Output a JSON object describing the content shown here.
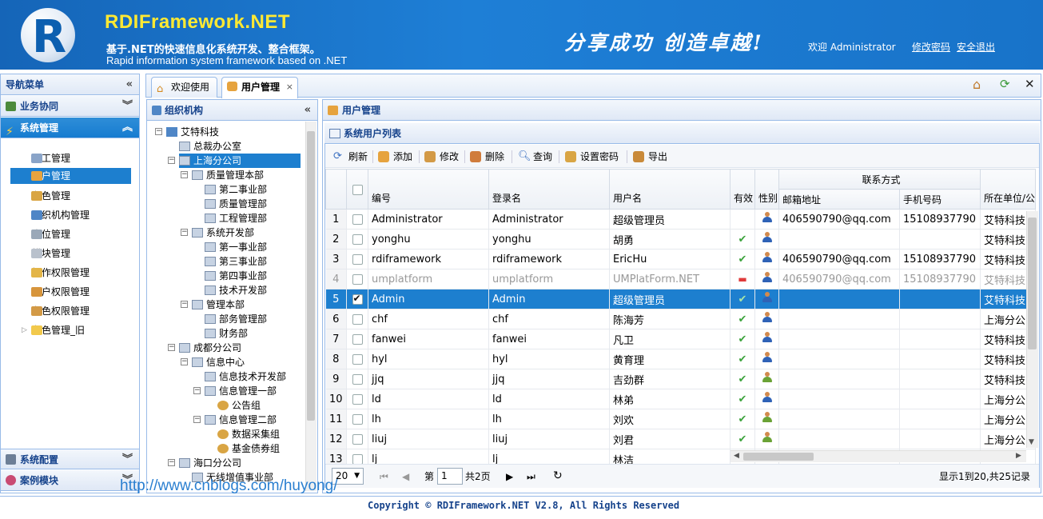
{
  "header": {
    "logo_letter": "R",
    "title": "RDIFramework.NET",
    "subtitle_cn": "基于.NET的快速信息化系统开发、整合框架。",
    "subtitle_en": "Rapid information system framework based on .NET",
    "slogan": "分享成功  创造卓越!",
    "welcome": "欢迎 Administrator",
    "change_password": "修改密码",
    "logout": "安全退出"
  },
  "nav": {
    "title": "导航菜单",
    "sections": [
      "业务协同",
      "系统管理"
    ],
    "items": [
      "员工管理",
      "用户管理",
      "角色管理",
      "组织机构管理",
      "岗位管理",
      "模块管理",
      "操作权限管理",
      "用户权限管理",
      "角色权限管理",
      "角色管理_旧"
    ],
    "bottom_sections": [
      "系统配置",
      "案例模块"
    ]
  },
  "tabs": [
    "欢迎使用",
    "用户管理"
  ],
  "tree": {
    "title": "组织机构",
    "nodes": [
      "艾特科技",
      "总裁办公室",
      "上海分公司",
      "质量管理本部",
      "第二事业部",
      "质量管理部",
      "工程管理部",
      "系统开发部",
      "第一事业部",
      "第三事业部",
      "第四事业部",
      "技术开发部",
      "管理本部",
      "部务管理部",
      "财务部",
      "成都分公司",
      "信息中心",
      "信息技术开发部",
      "信息管理一部",
      "公告组",
      "信息管理二部",
      "数据采集组",
      "基金债券组",
      "海口分公司",
      "无线增值事业部"
    ]
  },
  "main": {
    "title": "用户管理",
    "list_title": "系统用户列表",
    "toolbar": [
      "刷新",
      "添加",
      "修改",
      "删除",
      "查询",
      "设置密码",
      "导出"
    ],
    "group_header": "联系方式",
    "columns": [
      "编号",
      "登录名",
      "用户名",
      "有效",
      "性别",
      "邮箱地址",
      "手机号码",
      "所在单位/公"
    ],
    "rows": [
      {
        "n": "1",
        "code": "Administrator",
        "login": "Administrator",
        "name": "超级管理员",
        "valid": "",
        "gender": "m",
        "email": "406590790@qq.com",
        "mobile": "15108937790",
        "unit": "艾特科技"
      },
      {
        "n": "2",
        "code": "yonghu",
        "login": "yonghu",
        "name": "胡勇",
        "valid": "✔",
        "gender": "m",
        "email": "",
        "mobile": "",
        "unit": "艾特科技"
      },
      {
        "n": "3",
        "code": "rdiframework",
        "login": "rdiframework",
        "name": "EricHu",
        "valid": "✔",
        "gender": "m",
        "email": "406590790@qq.com",
        "mobile": "15108937790",
        "unit": "艾特科技"
      },
      {
        "n": "4",
        "code": "umplatform",
        "login": "umplatform",
        "name": "UMPlatForm.NET",
        "valid": "▬",
        "gender": "m",
        "email": "406590790@qq.com",
        "mobile": "15108937790",
        "unit": "艾特科技"
      },
      {
        "n": "5",
        "code": "Admin",
        "login": "Admin",
        "name": "超级管理员",
        "valid": "✔",
        "gender": "m",
        "email": "",
        "mobile": "",
        "unit": "艾特科技"
      },
      {
        "n": "6",
        "code": "chf",
        "login": "chf",
        "name": "陈海芳",
        "valid": "✔",
        "gender": "m",
        "email": "",
        "mobile": "",
        "unit": "上海分公"
      },
      {
        "n": "7",
        "code": "fanwei",
        "login": "fanwei",
        "name": "凡卫",
        "valid": "✔",
        "gender": "m",
        "email": "",
        "mobile": "",
        "unit": "艾特科技"
      },
      {
        "n": "8",
        "code": "hyl",
        "login": "hyl",
        "name": "黄育理",
        "valid": "✔",
        "gender": "m",
        "email": "",
        "mobile": "",
        "unit": "艾特科技"
      },
      {
        "n": "9",
        "code": "jjq",
        "login": "jjq",
        "name": "吉劲群",
        "valid": "✔",
        "gender": "f",
        "email": "",
        "mobile": "",
        "unit": "艾特科技"
      },
      {
        "n": "10",
        "code": "ld",
        "login": "ld",
        "name": "林弟",
        "valid": "✔",
        "gender": "m",
        "email": "",
        "mobile": "",
        "unit": "上海分公"
      },
      {
        "n": "11",
        "code": "lh",
        "login": "lh",
        "name": "刘欢",
        "valid": "✔",
        "gender": "f",
        "email": "",
        "mobile": "",
        "unit": "上海分公"
      },
      {
        "n": "12",
        "code": "liuj",
        "login": "liuj",
        "name": "刘君",
        "valid": "✔",
        "gender": "f",
        "email": "",
        "mobile": "",
        "unit": "上海分公"
      },
      {
        "n": "13",
        "code": "lj",
        "login": "lj",
        "name": "林洁",
        "valid": "",
        "gender": "",
        "email": "",
        "mobile": "",
        "unit": ""
      }
    ],
    "pager": {
      "page_size": "20",
      "page_prefix": "第",
      "page": "1",
      "page_total": "共2页",
      "summary": "显示1到20,共25记录"
    }
  },
  "watermark": "http://www.cnblogs.com/huyong/",
  "copyright": "Copyright © RDIFramework.NET V2.8, All Rights Reserved"
}
